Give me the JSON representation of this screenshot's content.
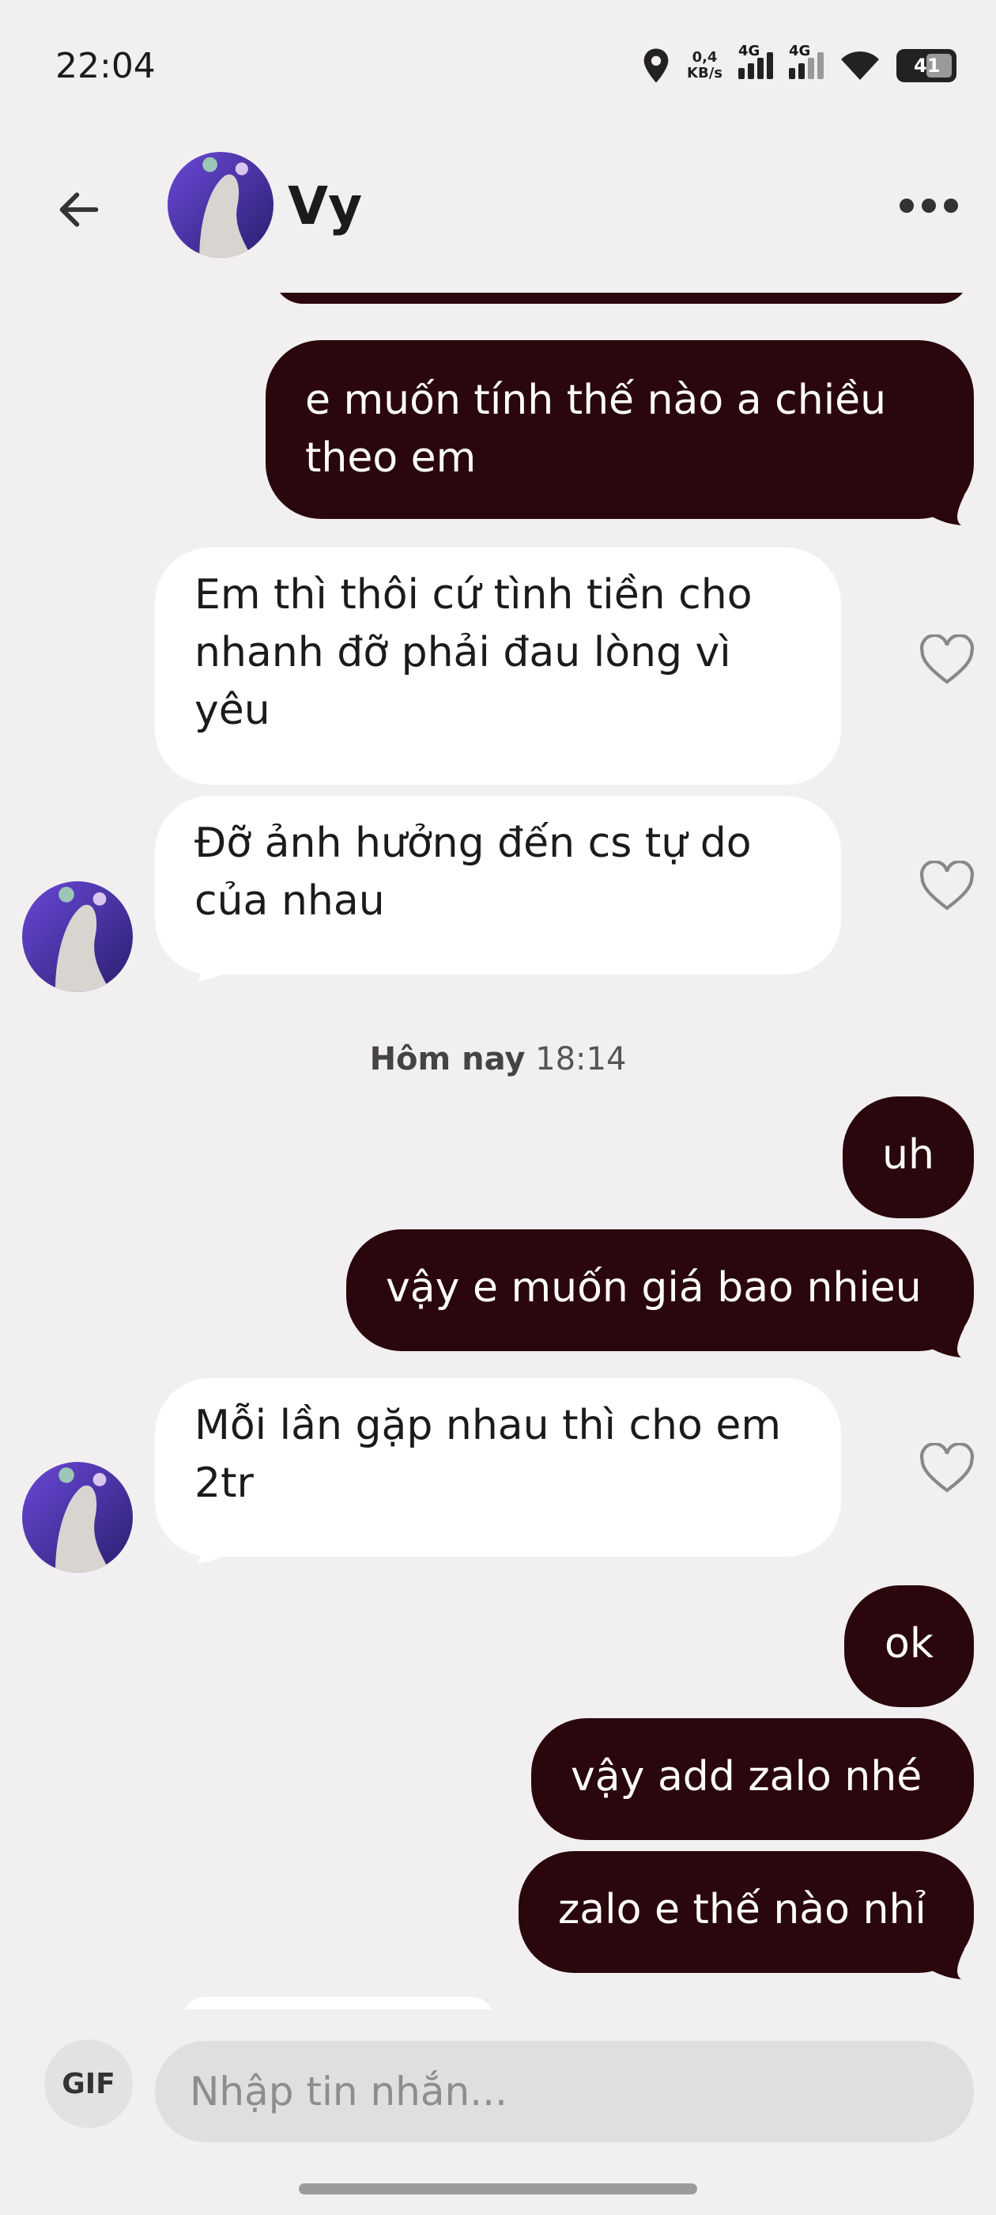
{
  "status_bar": {
    "time": "22:04",
    "speed_value": "0,4",
    "speed_unit": "KB/s",
    "network1": "4G",
    "network2": "4G",
    "battery": "41"
  },
  "header": {
    "contact_name": "Vy"
  },
  "messages": [
    {
      "direction": "out",
      "text": "e muốn tính thế nào a chiều theo em"
    },
    {
      "direction": "in",
      "text": "Em thì thôi cứ tình tiền cho nhanh đỡ phải đau lòng vì yêu"
    },
    {
      "direction": "in",
      "text": "Đỡ ảnh hưởng đến cs tự do của nhau"
    },
    {
      "direction": "out",
      "text": "uh"
    },
    {
      "direction": "out",
      "text": "vậy e muốn giá bao nhieu"
    },
    {
      "direction": "in",
      "text": "Mỗi lần gặp nhau thì cho em 2tr"
    },
    {
      "direction": "out",
      "text": "ok"
    },
    {
      "direction": "out",
      "text": "vậy add zalo nhé"
    },
    {
      "direction": "out",
      "text": "zalo e thế nào nhỉ"
    }
  ],
  "day_separator": {
    "day": "Hôm nay",
    "time": "18:14"
  },
  "composer": {
    "gif_label": "GIF",
    "placeholder": "Nhập tin nhắn..."
  },
  "colors": {
    "outgoing_bubble": "#2a070c",
    "incoming_bubble": "#ffffff",
    "background": "#f1eff0"
  }
}
